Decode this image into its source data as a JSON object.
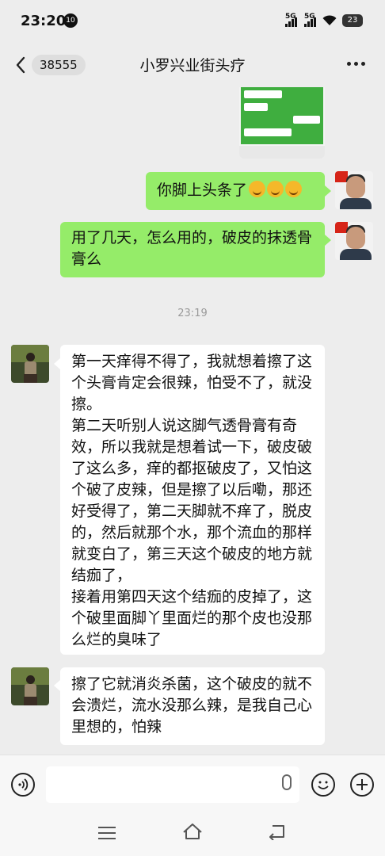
{
  "status_bar": {
    "time": "23:20",
    "notif_badge": "10",
    "net1": "5G",
    "net2": "5G",
    "battery": "23"
  },
  "header": {
    "unread_count": "38555",
    "title": "小罗兴业街头疗"
  },
  "messages": [
    {
      "side": "right",
      "text": "你脚上头条了",
      "emoji_count": 3,
      "emoji_name": "face-with-hand-over-mouth-icon"
    },
    {
      "side": "right",
      "text": "用了几天，怎么用的，破皮的抹透骨膏么"
    },
    {
      "side": "left",
      "text": "第一天痒得不得了，我就想着擦了这个头膏肯定会很辣，怕受不了，就没擦。\n第二天听别人说这脚气透骨膏有奇效，所以我就是想着试一下，破皮破了这么多，痒的都抠破皮了，又怕这个破了皮辣，但是擦了以后嘞，那还好受得了，第二天脚就不痒了，脱皮的，然后就那个水，那个流血的那样就变白了，第三天这个破皮的地方就结痂了，\n接着用第四天这个结痂的皮掉了，这个破里面脚丫里面烂的那个皮也没那么烂的臭味了"
    },
    {
      "side": "left",
      "text": "擦了它就消炎杀菌，这个破皮的就不会溃烂，流水没那么辣，是我自己心里想的，怕辣"
    }
  ],
  "timestamp": "23:19",
  "input": {
    "placeholder": ""
  },
  "colors": {
    "outgoing_bubble": "#95ec69",
    "incoming_bubble": "#ffffff",
    "background": "#ededed"
  }
}
